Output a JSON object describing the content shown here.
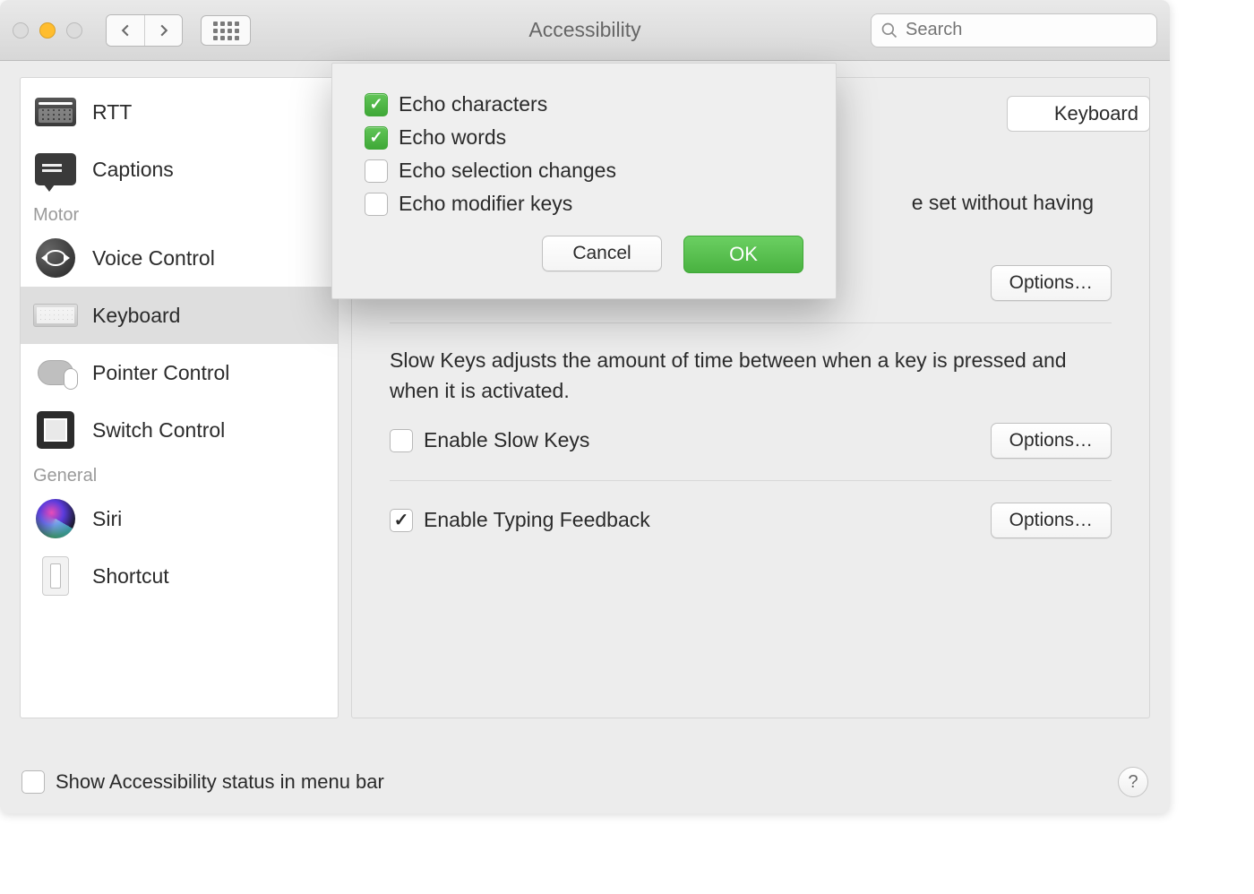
{
  "window_title": "Accessibility",
  "search": {
    "placeholder": "Search"
  },
  "sidebar": {
    "sections": [
      {
        "label": "",
        "items": [
          {
            "id": "rtt",
            "label": "RTT"
          },
          {
            "id": "captions",
            "label": "Captions"
          }
        ]
      },
      {
        "label": "Motor",
        "items": [
          {
            "id": "voice-control",
            "label": "Voice Control"
          },
          {
            "id": "keyboard",
            "label": "Keyboard",
            "selected": true
          },
          {
            "id": "pointer-control",
            "label": "Pointer Control"
          },
          {
            "id": "switch-control",
            "label": "Switch Control"
          }
        ]
      },
      {
        "label": "General",
        "items": [
          {
            "id": "siri",
            "label": "Siri"
          },
          {
            "id": "shortcut",
            "label": "Shortcut"
          }
        ]
      }
    ]
  },
  "main": {
    "tab_visible_label": "Keyboard",
    "sticky_desc_suffix": "e set without having",
    "options_label": "Options…",
    "slow_keys_desc": "Slow Keys adjusts the amount of time between when a key is pressed and when it is activated.",
    "slow_keys_check": "Enable Slow Keys",
    "typing_feedback_check": "Enable Typing Feedback"
  },
  "dialog": {
    "echo_characters": "Echo characters",
    "echo_words": "Echo words",
    "echo_selection": "Echo selection changes",
    "echo_modifier": "Echo modifier keys",
    "cancel": "Cancel",
    "ok": "OK"
  },
  "footer": {
    "menubar_label": "Show Accessibility status in menu bar"
  }
}
